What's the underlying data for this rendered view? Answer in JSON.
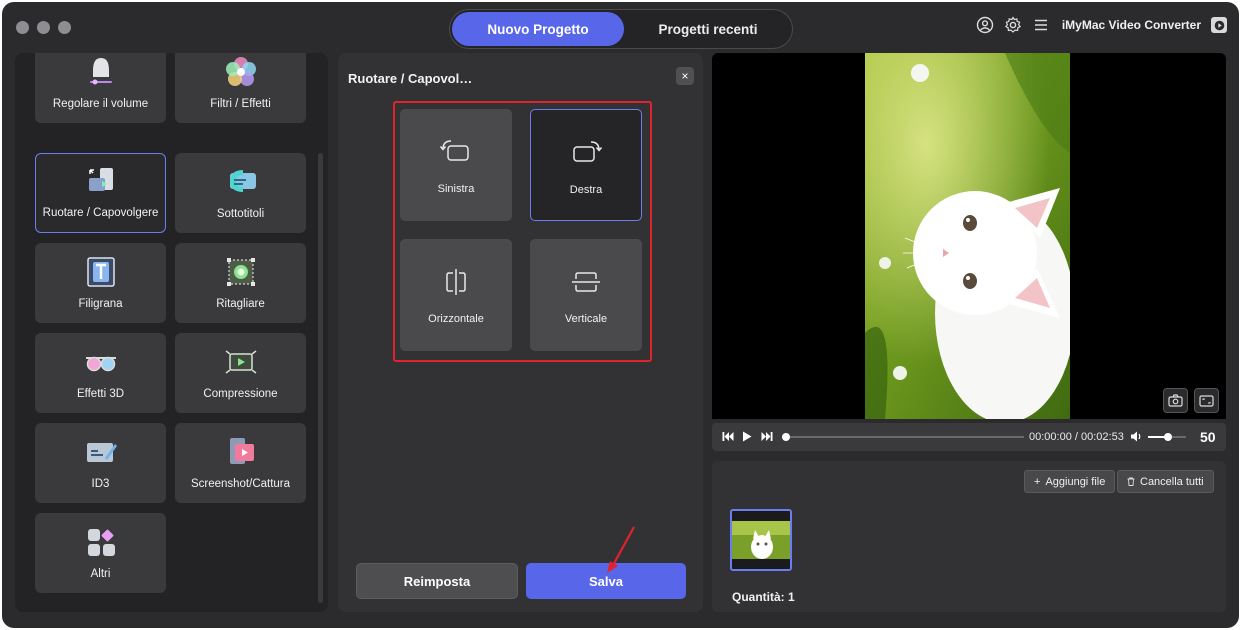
{
  "window": {
    "tabs": [
      {
        "label": "Nuovo Progetto",
        "active": true
      },
      {
        "label": "Progetti recenti",
        "active": false
      }
    ],
    "brand": "iMyMac Video Converter"
  },
  "tools": [
    {
      "label": "Regolare il volume",
      "icon": "volume-bell-icon"
    },
    {
      "label": "Filtri / Effetti",
      "icon": "filters-icon"
    },
    {
      "label": "Ruotare / Capovolgere",
      "icon": "rotate-icon",
      "selected": true
    },
    {
      "label": "Sottotitoli",
      "icon": "subtitles-icon"
    },
    {
      "label": "Filigrana",
      "icon": "watermark-icon"
    },
    {
      "label": "Ritagliare",
      "icon": "crop-icon"
    },
    {
      "label": "Effetti 3D",
      "icon": "3d-glasses-icon"
    },
    {
      "label": "Compressione",
      "icon": "compression-icon"
    },
    {
      "label": "ID3",
      "icon": "id3-icon"
    },
    {
      "label": "Screenshot/Cattura",
      "icon": "screenshot-icon"
    },
    {
      "label": "Altri",
      "icon": "more-icon"
    }
  ],
  "rotate_panel": {
    "title": "Ruotare / Capovol…",
    "close": "×",
    "options": [
      {
        "label": "Sinistra",
        "icon": "rotate-left-icon"
      },
      {
        "label": "Destra",
        "icon": "rotate-right-icon",
        "selected": true
      },
      {
        "label": "Orizzontale",
        "icon": "flip-horizontal-icon"
      },
      {
        "label": "Verticale",
        "icon": "flip-vertical-icon"
      }
    ],
    "reset_label": "Reimposta",
    "save_label": "Salva"
  },
  "player": {
    "time": "00:00:00 / 00:02:53",
    "volume": "50",
    "progress": 0,
    "volume_level": 0.5
  },
  "files": {
    "add_label": "Aggiungi file",
    "clear_label": "Cancella tutti",
    "quantity": "Quantità: 1"
  },
  "colors": {
    "accent": "#5867ea",
    "highlight_box": "#e0232d",
    "selected_border": "#6b7ef0"
  }
}
